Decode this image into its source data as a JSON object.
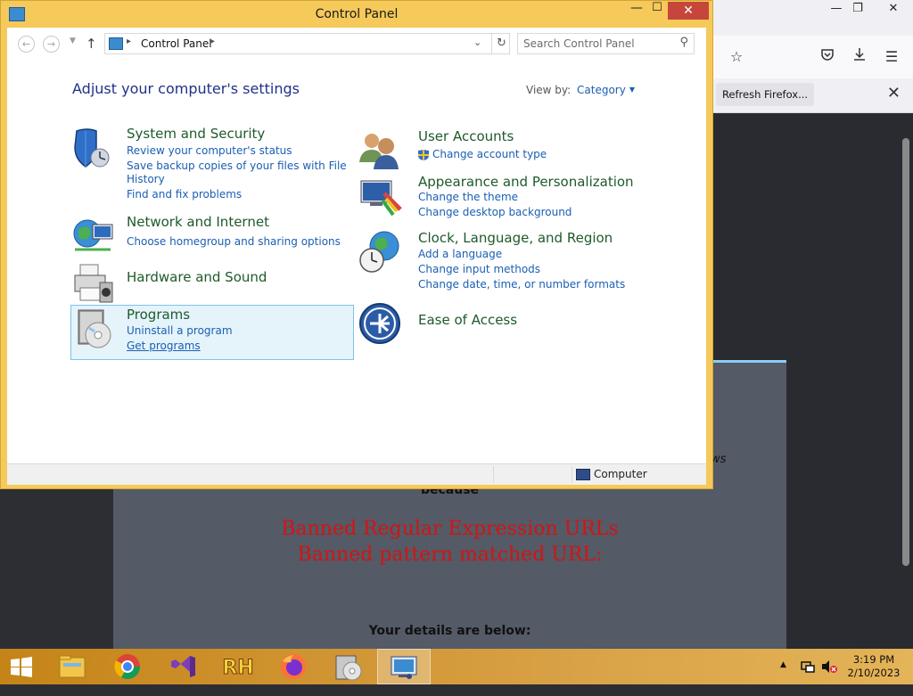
{
  "control_panel": {
    "title": "Control Panel",
    "address_crumb": "Control Panel",
    "search_placeholder": "Search Control Panel",
    "heading": "Adjust your computer's settings",
    "view_by_label": "View by:",
    "view_by_value": "Category",
    "categories": [
      {
        "title": "System and Security",
        "links": [
          "Review your computer's status",
          "Save backup copies of your files with File",
          "History",
          "Find and fix problems"
        ]
      },
      {
        "title": "Network and Internet",
        "links": [
          "Choose homegroup and sharing options"
        ]
      },
      {
        "title": "Hardware and Sound",
        "links": []
      },
      {
        "title": "Programs",
        "links": [
          "Uninstall a program",
          "Get programs"
        ]
      },
      {
        "title": "User Accounts",
        "links": [
          "Change account type"
        ]
      },
      {
        "title": "Appearance and Personalization",
        "links": [
          "Change the theme",
          "Change desktop background"
        ]
      },
      {
        "title": "Clock, Language, and Region",
        "links": [
          "Add a language",
          "Change input methods",
          "Change date, time, or number formats"
        ]
      },
      {
        "title": "Ease of Access",
        "links": []
      }
    ],
    "status_text": "Computer"
  },
  "firefox": {
    "refresh_label": "Refresh Firefox..."
  },
  "block_page": {
    "because": "because",
    "banned_line1": "Banned Regular Expression URLs",
    "banned_line2": "Banned pattern matched URL:",
    "details": "Your details are below:",
    "partial_word": "ws"
  },
  "taskbar": {
    "apps": [
      "file-explorer",
      "chrome",
      "visual-studio",
      "rh-app",
      "firefox",
      "disk-app",
      "control-panel"
    ],
    "time": "3:19 PM",
    "date": "2/10/2023"
  },
  "colors": {
    "window_frame": "#f5c95a",
    "link": "#1a5fb4",
    "category_title": "#1e5a2a",
    "heading": "#1e3287",
    "close_button": "#c7463b",
    "banned_text": "#d21414"
  }
}
